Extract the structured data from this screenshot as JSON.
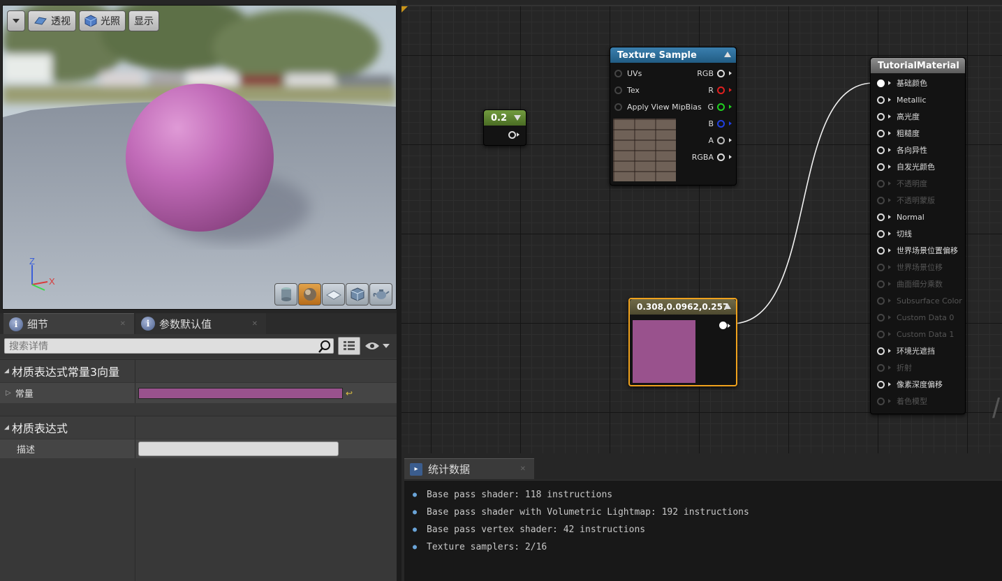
{
  "viewport": {
    "toolbar": {
      "perspective_label": "透视",
      "lighting_label": "光照",
      "show_label": "显示"
    },
    "axis": {
      "z": "Z",
      "x": "X"
    }
  },
  "details": {
    "tabs": [
      {
        "label": "细节"
      },
      {
        "label": "参数默认值"
      }
    ],
    "search_placeholder": "搜索详情",
    "sections": [
      {
        "title": "材质表达式常量3向量",
        "row_label": "常量",
        "row_color": "#99528d"
      },
      {
        "title": "材质表达式",
        "row_label": "描述"
      }
    ]
  },
  "graph": {
    "texture_node": {
      "title": "Texture Sample",
      "inputs": [
        "UVs",
        "Tex",
        "Apply View MipBias"
      ],
      "outputs": [
        "RGB",
        "R",
        "G",
        "B",
        "A",
        "RGBA"
      ]
    },
    "constant_node": {
      "value": "0.2"
    },
    "vector3_node": {
      "value": "0.308,0.0962,0.257",
      "color": "#99528d"
    },
    "material_node": {
      "title": "TutorialMaterial",
      "pins": [
        {
          "label": "基础颜色",
          "enabled": true
        },
        {
          "label": "Metallic",
          "enabled": true
        },
        {
          "label": "高光度",
          "enabled": true
        },
        {
          "label": "粗糙度",
          "enabled": true
        },
        {
          "label": "各向异性",
          "enabled": true
        },
        {
          "label": "自发光颜色",
          "enabled": true
        },
        {
          "label": "不透明度",
          "enabled": false
        },
        {
          "label": "不透明蒙版",
          "enabled": false
        },
        {
          "label": "Normal",
          "enabled": true
        },
        {
          "label": "切线",
          "enabled": true
        },
        {
          "label": "世界场景位置偏移",
          "enabled": true
        },
        {
          "label": "世界场景位移",
          "enabled": false
        },
        {
          "label": "曲面细分乘数",
          "enabled": false
        },
        {
          "label": "Subsurface Color",
          "enabled": false
        },
        {
          "label": "Custom Data 0",
          "enabled": false
        },
        {
          "label": "Custom Data 1",
          "enabled": false
        },
        {
          "label": "环境光遮挡",
          "enabled": true
        },
        {
          "label": "折射",
          "enabled": false
        },
        {
          "label": "像素深度偏移",
          "enabled": true
        },
        {
          "label": "着色模型",
          "enabled": false
        }
      ]
    }
  },
  "stats": {
    "tab_label": "统计数据",
    "lines": [
      "Base pass shader: 118 instructions",
      "Base pass shader with Volumetric Lightmap: 192 instructions",
      "Base pass vertex shader: 42 instructions",
      "Texture samplers: 2/16"
    ]
  }
}
